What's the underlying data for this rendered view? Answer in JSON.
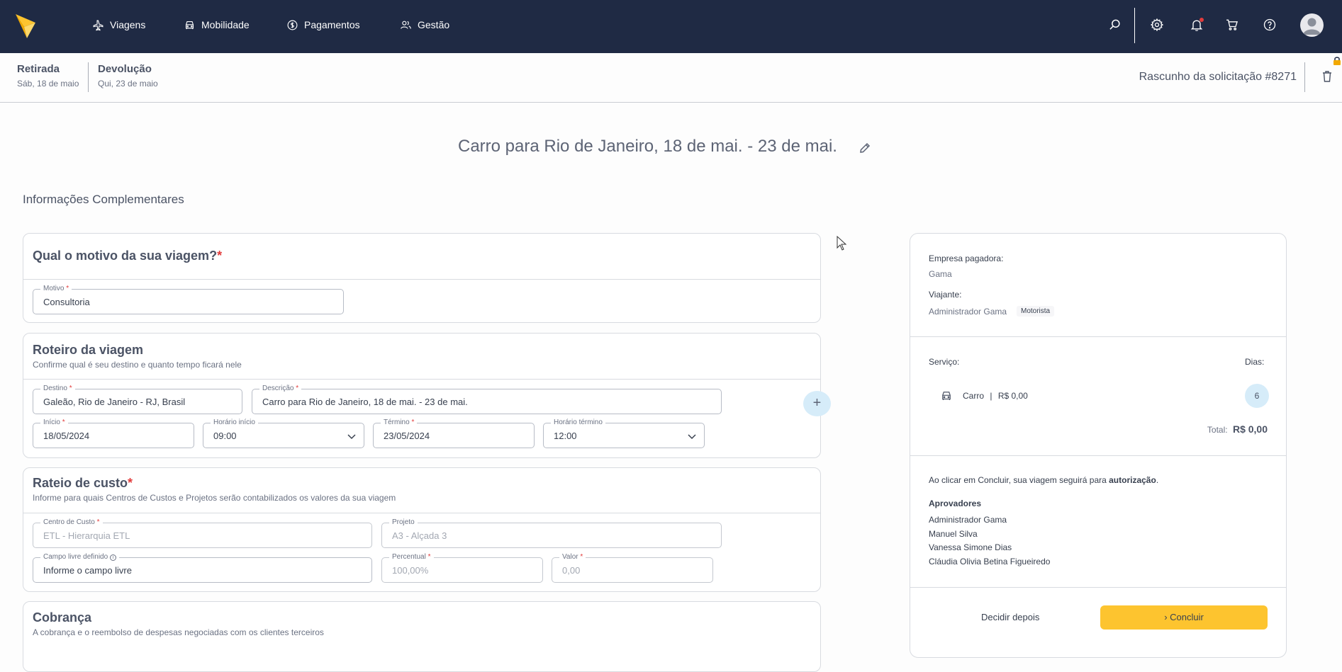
{
  "nav": {
    "items": [
      {
        "label": "Viagens",
        "icon": "airplane-icon"
      },
      {
        "label": "Mobilidade",
        "icon": "car-icon"
      },
      {
        "label": "Pagamentos",
        "icon": "dollar-icon"
      },
      {
        "label": "Gestão",
        "icon": "users-icon"
      }
    ],
    "right_icons": [
      "search-icon",
      "gear-icon",
      "bell-icon",
      "cart-icon",
      "help-icon",
      "avatar-icon"
    ]
  },
  "subheader": {
    "pickup_label": "Retirada",
    "pickup_date": "Sáb, 18 de maio",
    "return_label": "Devolução",
    "return_date": "Qui, 23 de maio",
    "draft": "Rascunho da solicitação #8271"
  },
  "page": {
    "title": "Carro para Rio de Janeiro, 18 de mai. - 23 de mai.",
    "section_heading": "Informações Complementares"
  },
  "motivo": {
    "title": "Qual o motivo da sua viagem?",
    "field_label": "Motivo",
    "field_value": "Consultoria"
  },
  "roteiro": {
    "title": "Roteiro da viagem",
    "subtitle": "Confirme qual é seu destino e quanto tempo ficará nele",
    "destino_label": "Destino",
    "destino_value": "Galeão, Rio de Janeiro - RJ, Brasil",
    "descricao_label": "Descrição",
    "descricao_value": "Carro para Rio de Janeiro, 18 de mai. - 23 de mai.",
    "inicio_label": "Início",
    "inicio_value": "18/05/2024",
    "horario_inicio_label": "Horário início",
    "horario_inicio_value": "09:00",
    "termino_label": "Término",
    "termino_value": "23/05/2024",
    "horario_termino_label": "Horário término",
    "horario_termino_value": "12:00",
    "add_label": "+"
  },
  "rateio": {
    "title": "Rateio de custo",
    "subtitle": "Informe para quais Centros de Custos e Projetos serão contabilizados os valores da sua viagem",
    "centro_label": "Centro de Custo",
    "centro_value": "ETL - Hierarquia ETL",
    "projeto_label": "Projeto",
    "projeto_value": "A3 - Alçada 3",
    "campo_label": "Campo livre definido",
    "campo_value": "Informe o campo livre",
    "percentual_label": "Percentual",
    "percentual_value": "100,00%",
    "valor_label": "Valor",
    "valor_value": "0,00"
  },
  "cobranca": {
    "title": "Cobrança",
    "subtitle": "A cobrança e o reembolso de despesas negociadas com os clientes terceiros"
  },
  "panel": {
    "empresa_label": "Empresa pagadora:",
    "empresa_value": "Gama",
    "viajante_label": "Viajante:",
    "viajante_value": "Administrador Gama",
    "viajante_badge": "Motorista",
    "servico_label": "Serviço:",
    "dias_label": "Dias:",
    "servico_name": "Carro",
    "servico_sep": "|",
    "servico_price": "R$ 0,00",
    "dias_value": "6",
    "total_label": "Total:",
    "total_value": "R$ 0,00",
    "notice_prefix": "Ao clicar em Concluir, sua viagem seguirá para ",
    "notice_bold": "autorização",
    "notice_suffix": ".",
    "aprovadores_label": "Aprovadores",
    "aprovadores": [
      "Administrador Gama",
      "Manuel Silva",
      "Vanessa Simone Dias",
      "Cláudia Olivia Betina Figueiredo"
    ],
    "decide_later": "Decidir depois",
    "conclude": "› Concluir"
  },
  "colors": {
    "nav_bg": "#1f2a44",
    "accent_yellow": "#fdc42f",
    "light_blue": "#d6ecf9",
    "required_red": "#e23c3c"
  }
}
